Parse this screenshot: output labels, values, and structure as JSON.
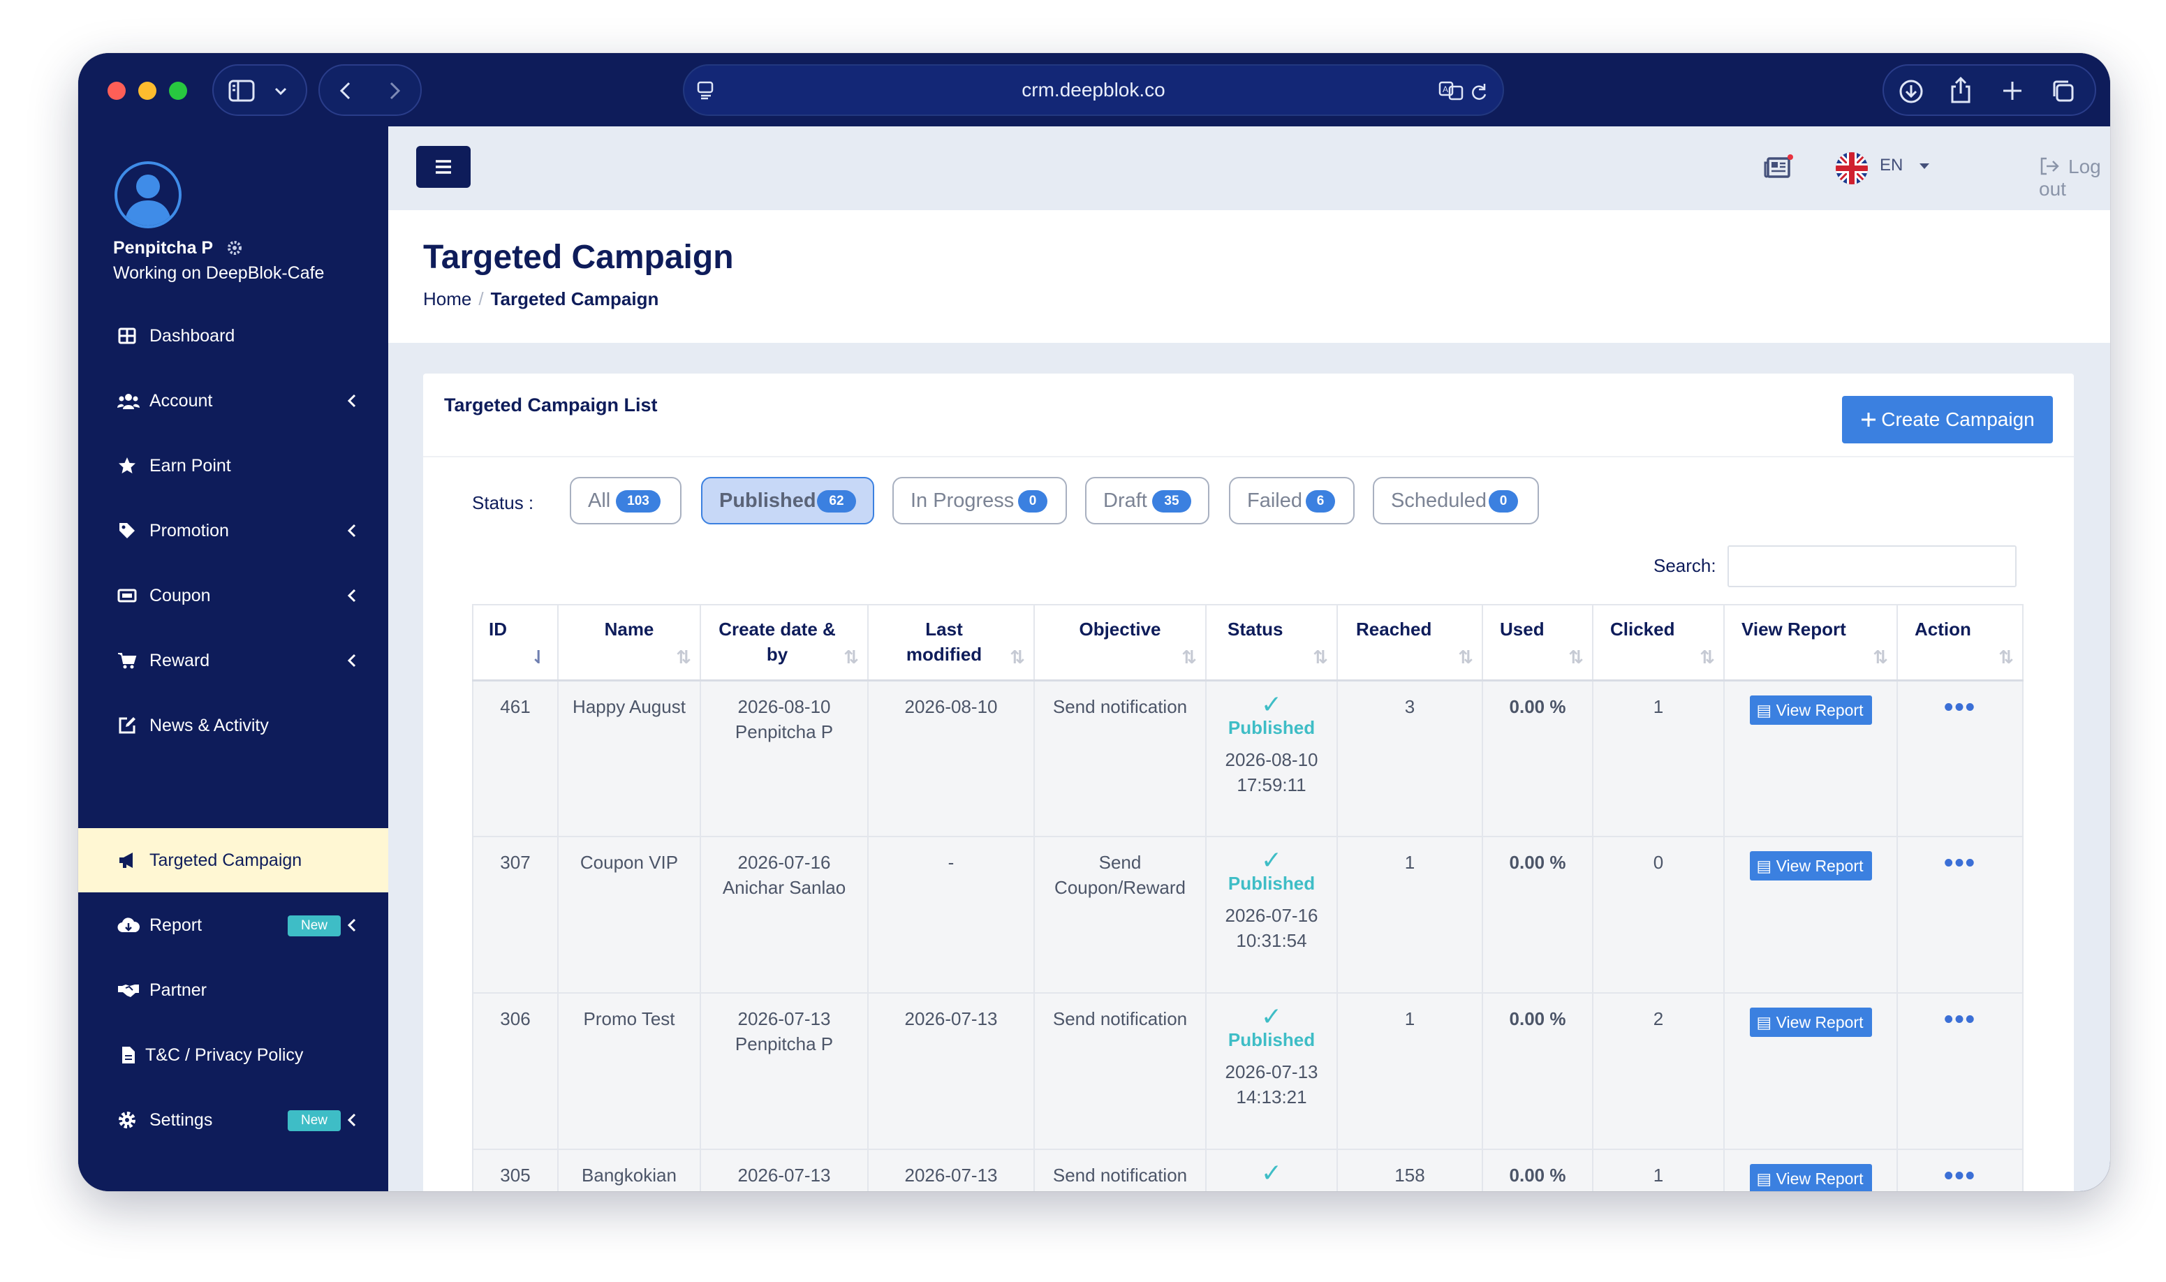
{
  "browser": {
    "url": "crm.deepblok.co"
  },
  "sidebar": {
    "user_name": "Penpitcha P",
    "user_org": "Working on DeepBlok-Cafe",
    "items": [
      {
        "label": "Dashboard",
        "icon": "grid-icon"
      },
      {
        "label": "Account",
        "icon": "users-icon"
      },
      {
        "label": "Earn Point",
        "icon": "star-icon"
      },
      {
        "label": "Promotion",
        "icon": "tag-icon"
      },
      {
        "label": "Coupon",
        "icon": "ticket-icon"
      },
      {
        "label": "Reward",
        "icon": "cart-icon"
      },
      {
        "label": "News & Activity",
        "icon": "edit-icon"
      },
      {
        "label": "Targeted Campaign",
        "icon": "megaphone-icon"
      },
      {
        "label": "Report",
        "icon": "cloud-icon",
        "badge": "New"
      },
      {
        "label": "Partner",
        "icon": "handshake-icon"
      },
      {
        "label": "T&C / Privacy Policy",
        "icon": "file-icon"
      },
      {
        "label": "Settings",
        "icon": "gear-icon",
        "badge": "New"
      }
    ]
  },
  "header": {
    "language": "EN",
    "logout_label": "Log out"
  },
  "page": {
    "title": "Targeted Campaign",
    "breadcrumb": {
      "home": "Home",
      "current": "Targeted Campaign"
    }
  },
  "card": {
    "title": "Targeted Campaign List",
    "create_button": "Create Campaign",
    "status_label": "Status :",
    "search_label": "Search:",
    "search_value": "",
    "filters": [
      {
        "label": "All",
        "count": "103",
        "selected": false
      },
      {
        "label": "Published",
        "count": "62",
        "selected": true
      },
      {
        "label": "In Progress",
        "count": "0",
        "selected": false
      },
      {
        "label": "Draft",
        "count": "35",
        "selected": false
      },
      {
        "label": "Failed",
        "count": "6",
        "selected": false
      },
      {
        "label": "Scheduled",
        "count": "0",
        "selected": false
      }
    ]
  },
  "table": {
    "columns": [
      "ID",
      "Name",
      "Create date & by",
      "Last modified",
      "Objective",
      "Status",
      "Reached",
      "Used",
      "Clicked",
      "View Report",
      "Action"
    ],
    "view_report_label": "View Report",
    "rows": [
      {
        "id": "461",
        "name": "Happy August",
        "create_date": "2026-08-10",
        "create_by": "Penpitcha P",
        "last_modified": "2026-08-10",
        "objective": "Send notification",
        "status": "Published",
        "status_date": "2026-08-10",
        "status_time": "17:59:11",
        "reached": "3",
        "used": "0.00 %",
        "clicked": "1"
      },
      {
        "id": "307",
        "name": "Coupon VIP",
        "create_date": "2026-07-16",
        "create_by": "Anichar Sanlao",
        "last_modified": "-",
        "objective": "Send Coupon/Reward",
        "status": "Published",
        "status_date": "2026-07-16",
        "status_time": "10:31:54",
        "reached": "1",
        "used": "0.00 %",
        "clicked": "0"
      },
      {
        "id": "306",
        "name": "Promo Test",
        "create_date": "2026-07-13",
        "create_by": "Penpitcha P",
        "last_modified": "2026-07-13",
        "objective": "Send notification",
        "status": "Published",
        "status_date": "2026-07-13",
        "status_time": "14:13:21",
        "reached": "1",
        "used": "0.00 %",
        "clicked": "2"
      },
      {
        "id": "305",
        "name": "Bangkokian",
        "create_date": "2026-07-13",
        "create_by": "",
        "last_modified": "2026-07-13",
        "objective": "Send notification",
        "status": "",
        "status_date": "",
        "status_time": "",
        "reached": "158",
        "used": "0.00 %",
        "clicked": "1"
      }
    ]
  },
  "colors": {
    "navy": "#0e1c5a",
    "accent_blue": "#3b80e0",
    "teal_status": "#3ebdc6",
    "active_nav_bg": "#fff7d3"
  }
}
